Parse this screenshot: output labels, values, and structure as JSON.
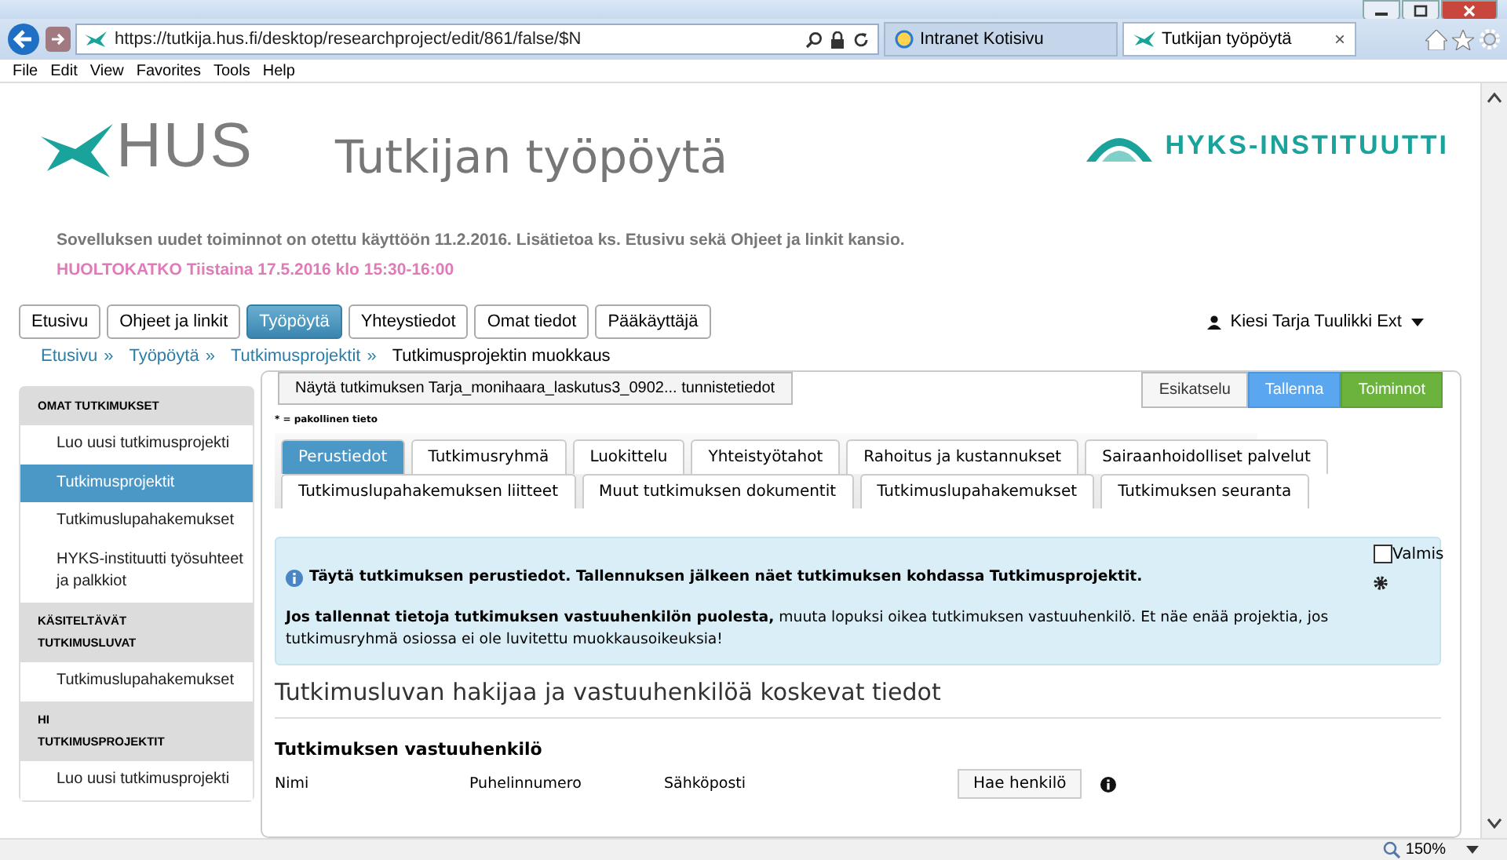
{
  "browser": {
    "url": "https://tutkija.hus.fi/desktop/researchproject/edit/861/false/$N",
    "tabs": [
      {
        "label": "Intranet Kotisivu",
        "selected": false
      },
      {
        "label": "Tutkijan työpöytä",
        "selected": true
      }
    ],
    "close_tab": "×",
    "menu": [
      "File",
      "Edit",
      "View",
      "Favorites",
      "Tools",
      "Help"
    ]
  },
  "header": {
    "logo_text": "HUS",
    "title": "Tutkijan työpöytä",
    "partner_logo_text": "HYKS-INSTITUUTTI"
  },
  "notices": [
    {
      "kind": "info",
      "text": "Sovelluksen uudet toiminnot on otettu käyttöön 11.2.2016. Lisätietoa ks. Etusivu sekä Ohjeet ja linkit kansio."
    },
    {
      "kind": "alert",
      "text": "HUOLTOKATKO Tiistaina 17.5.2016 klo 15:30-16:00"
    }
  ],
  "nav": [
    {
      "label": "Etusivu",
      "selected": false
    },
    {
      "label": "Ohjeet ja linkit",
      "selected": false
    },
    {
      "label": "Työpöytä",
      "selected": true
    },
    {
      "label": "Yhteystiedot",
      "selected": false
    },
    {
      "label": "Omat tiedot",
      "selected": false
    },
    {
      "label": "Pääkäyttäjä",
      "selected": false
    }
  ],
  "user_menu": "Kiesi Tarja Tuulikki Ext",
  "breadcrumbs": {
    "separator": "»",
    "items": [
      "Etusivu",
      "Työpöytä",
      "Tutkimusprojektit"
    ],
    "current": "Tutkimusprojektin muokkaus"
  },
  "sidebar": [
    {
      "heading": "OMAT TUTKIMUKSET",
      "items": [
        {
          "label": "Luo uusi tutkimusprojekti",
          "selected": false
        },
        {
          "label": "Tutkimusprojektit",
          "selected": true
        },
        {
          "label": "Tutkimuslupahakemukset",
          "selected": false
        },
        {
          "label": "HYKS-instituutti työsuhteet ja palkkiot",
          "selected": false
        }
      ]
    },
    {
      "heading": "KÄSITELTÄVÄT TUTKIMUSLUVAT",
      "items": [
        {
          "label": "Tutkimuslupahakemukset",
          "selected": false
        }
      ]
    },
    {
      "heading": "HI TUTKIMUSPROJEKTIT",
      "items": [
        {
          "label": "Luo uusi tutkimusprojekti",
          "selected": false
        }
      ]
    }
  ],
  "toolbar": {
    "identity_button": "Näytä tutkimuksen Tarja_monihaara_laskutus3_0902... tunnistetiedot",
    "actions": [
      {
        "label": "Esikatselu",
        "kind": "plain"
      },
      {
        "label": "Tallenna",
        "kind": "primary"
      },
      {
        "label": "Toiminnot",
        "kind": "success"
      }
    ]
  },
  "required_note": "* = pakollinen tieto",
  "form_tabs": [
    [
      {
        "label": "Perustiedot",
        "selected": true
      },
      {
        "label": "Tutkimusryhmä",
        "selected": false
      },
      {
        "label": "Luokittelu",
        "selected": false
      },
      {
        "label": "Yhteistyötahot",
        "selected": false
      },
      {
        "label": "Rahoitus ja kustannukset",
        "selected": false
      },
      {
        "label": "Sairaanhoidolliset palvelut",
        "selected": false
      }
    ],
    [
      {
        "label": "Tutkimuslupahakemuksen liitteet",
        "selected": false
      },
      {
        "label": "Muut tutkimuksen dokumentit",
        "selected": false
      },
      {
        "label": "Tutkimuslupahakemukset",
        "selected": false
      },
      {
        "label": "Tutkimuksen seuranta",
        "selected": false
      }
    ]
  ],
  "info_box": {
    "lines": [
      "**Täytä tutkimuksen perustiedot. Tallennuksen jälkeen näet tutkimuksen kohdassa Tutkimusprojektit.**",
      "**Jos tallennat tietoja tutkimuksen vastuuhenkilön puolesta,** muuta lopuksi oikea tutkimuksen vastuuhenkilö. Et näe enää projektia, jos tutkimusryhmä osiossa ei ole luvitettu muokkausoikeuksia!"
    ],
    "valmis": {
      "label": "Valmis",
      "checked": false
    }
  },
  "section_title": "Tutkimusluvan hakijaa ja vastuuhenkilöä koskevat tiedot",
  "subsection_title": "Tutkimuksen vastuuhenkilö",
  "fields": [
    "Nimi",
    "Puhelinnumero",
    "Sähköposti"
  ],
  "search_button": "Hae henkilö",
  "status_bar": {
    "zoom": "150%"
  }
}
